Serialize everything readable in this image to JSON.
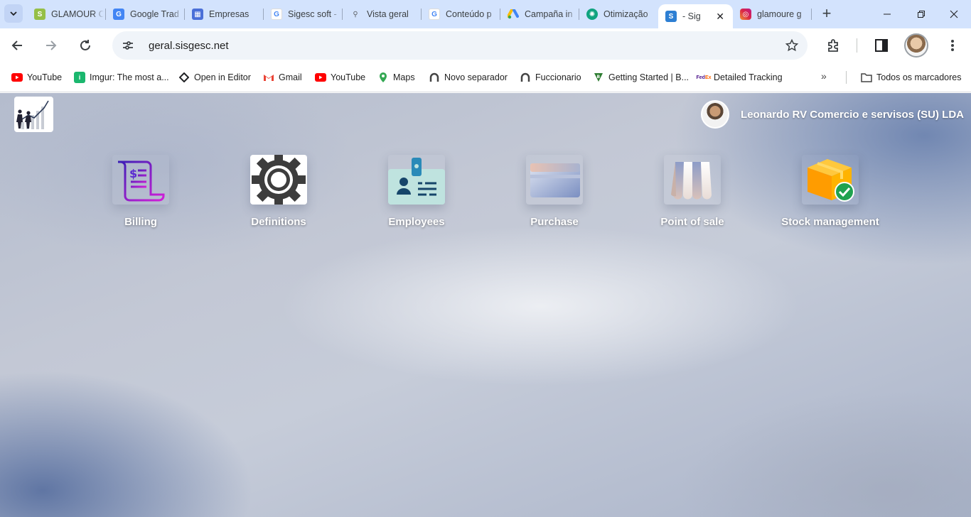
{
  "browser": {
    "tabs": [
      {
        "title": "GLAMOUR C",
        "icon": "shopify-icon",
        "color": "#95bf47"
      },
      {
        "title": "Google Trad",
        "icon": "google-translate-icon",
        "color": "#4285f4"
      },
      {
        "title": "Empresas",
        "icon": "business-icon",
        "color": "#4a6fd8"
      },
      {
        "title": "Sigesc soft -",
        "icon": "google-icon",
        "color": "#4285f4"
      },
      {
        "title": "Vista geral",
        "icon": "analytics-icon",
        "color": "#5f6368"
      },
      {
        "title": "Conteúdo p",
        "icon": "google-icon",
        "color": "#4285f4"
      },
      {
        "title": "Campaña in",
        "icon": "google-ads-icon",
        "color": "#fbbc04"
      },
      {
        "title": "Otimização",
        "icon": "chatgpt-icon",
        "color": "#10a37f"
      },
      {
        "title": "- Sig",
        "icon": "sigesc-icon",
        "color": "#2d7fd3",
        "active": true
      },
      {
        "title": "glamoure g",
        "icon": "instagram-icon",
        "color": "#d6249f"
      }
    ],
    "address": "geral.sisgesc.net",
    "bookmarks": [
      {
        "label": "YouTube",
        "icon": "youtube-icon"
      },
      {
        "label": "Imgur: The most a...",
        "icon": "imgur-icon"
      },
      {
        "label": "Open in Editor",
        "icon": "editor-icon"
      },
      {
        "label": "Gmail",
        "icon": "gmail-icon"
      },
      {
        "label": "YouTube",
        "icon": "youtube-icon"
      },
      {
        "label": "Maps",
        "icon": "maps-icon"
      },
      {
        "label": "Novo separador",
        "icon": "separator-icon"
      },
      {
        "label": "Fuccionario",
        "icon": "separator-icon"
      },
      {
        "label": "Getting Started | B...",
        "icon": "bookmark-site-icon"
      },
      {
        "label": "Detailed Tracking",
        "icon": "fedex-icon"
      }
    ],
    "all_bookmarks": "Todos os marcadores"
  },
  "app": {
    "company": "Leonardo RV Comercio e servisos (SU) LDA",
    "modules": [
      {
        "label": "Billing",
        "icon": "billing-icon"
      },
      {
        "label": "Definitions",
        "icon": "gear-icon"
      },
      {
        "label": "Employees",
        "icon": "employee-badge-icon"
      },
      {
        "label": "Purchase",
        "icon": "credit-card-icon"
      },
      {
        "label": "Point of sale",
        "icon": "store-awning-icon"
      },
      {
        "label": "Stock management",
        "icon": "stock-box-icon"
      }
    ]
  }
}
